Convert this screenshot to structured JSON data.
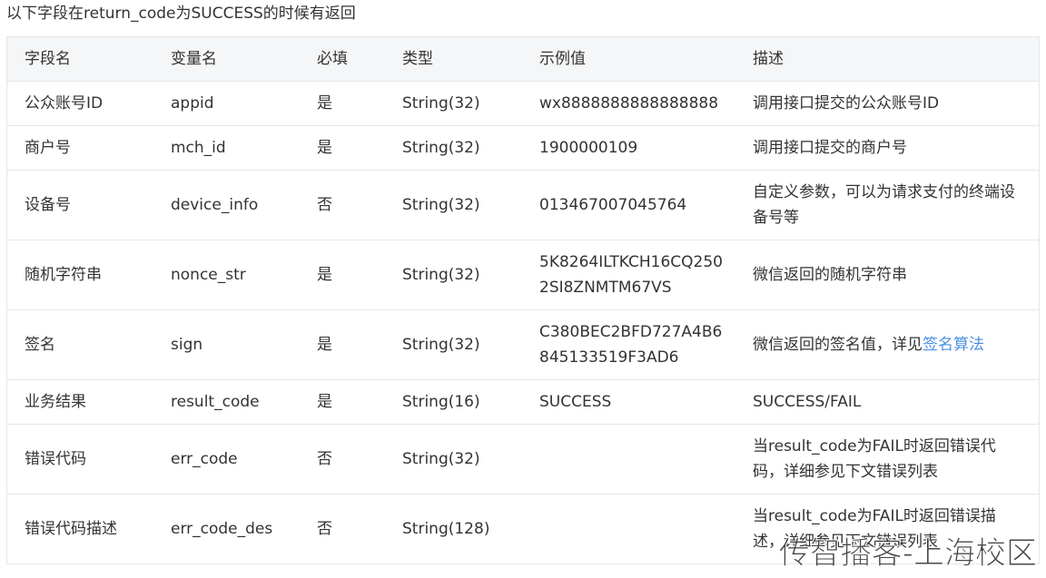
{
  "intro": "以下字段在return_code为SUCCESS的时候有返回",
  "table": {
    "headers": [
      "字段名",
      "变量名",
      "必填",
      "类型",
      "示例值",
      "描述"
    ],
    "rows": [
      {
        "field": "公众账号ID",
        "var": "appid",
        "required": "是",
        "type": "String(32)",
        "example": "wx8888888888888888",
        "desc": "调用接口提交的公众账号ID"
      },
      {
        "field": "商户号",
        "var": "mch_id",
        "required": "是",
        "type": "String(32)",
        "example": "1900000109",
        "desc": "调用接口提交的商户号"
      },
      {
        "field": "设备号",
        "var": "device_info",
        "required": "否",
        "type": "String(32)",
        "example": "013467007045764",
        "desc": "自定义参数，可以为请求支付的终端设备号等"
      },
      {
        "field": "随机字符串",
        "var": "nonce_str",
        "required": "是",
        "type": "String(32)",
        "example": "5K8264ILTKCH16CQ2502SI8ZNMTM67VS",
        "desc": "微信返回的随机字符串"
      },
      {
        "field": "签名",
        "var": "sign",
        "required": "是",
        "type": "String(32)",
        "example": "C380BEC2BFD727A4B6845133519F3AD6",
        "desc": "微信返回的签名值，详见",
        "desc_link": "签名算法"
      },
      {
        "field": "业务结果",
        "var": "result_code",
        "required": "是",
        "type": "String(16)",
        "example": "SUCCESS",
        "desc": "SUCCESS/FAIL"
      },
      {
        "field": "错误代码",
        "var": "err_code",
        "required": "否",
        "type": "String(32)",
        "example": "",
        "desc": "当result_code为FAIL时返回错误代码，详细参见下文错误列表"
      },
      {
        "field": "错误代码描述",
        "var": "err_code_des",
        "required": "否",
        "type": "String(128)",
        "example": "",
        "desc": "当result_code为FAIL时返回错误描述，详细参见下文错误列表"
      }
    ]
  },
  "watermark": "传智播客-上海校区"
}
